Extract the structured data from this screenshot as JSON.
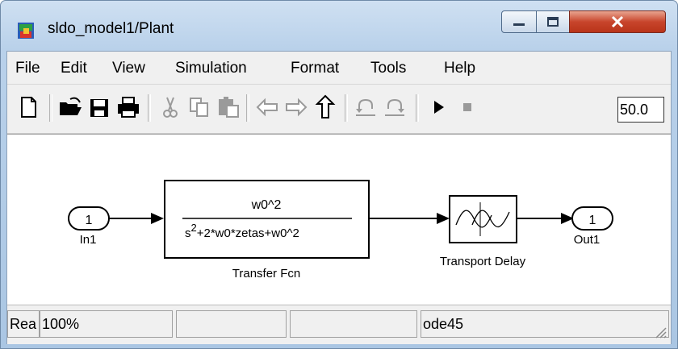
{
  "window": {
    "title": "sldo_model1/Plant"
  },
  "menu": [
    "File",
    "Edit",
    "View",
    "Simulation",
    "Format",
    "Tools",
    "Help"
  ],
  "toolbar": {
    "icons": [
      "new-icon",
      "open-icon",
      "save-icon",
      "print-icon",
      "cut-icon",
      "copy-icon",
      "paste-icon",
      "back-icon",
      "forward-icon",
      "up-icon",
      "undo-icon",
      "redo-icon",
      "play-icon",
      "stop-icon"
    ],
    "stop_time": "50.0"
  },
  "diagram": {
    "inport": {
      "number": "1",
      "label": "In1"
    },
    "transfer_fcn": {
      "numerator": "w0^2",
      "den_s": "s",
      "den_exp": "2",
      "den_rest": "+2*w0*zetas+w0^2",
      "label": "Transfer Fcn"
    },
    "transport_delay": {
      "label": "Transport Delay"
    },
    "outport": {
      "number": "1",
      "label": "Out1"
    }
  },
  "status": {
    "ready": "Rea",
    "zoom": "100%",
    "panel3": "",
    "panel4": "",
    "solver": "ode45"
  },
  "colors": {
    "close_button": "#c8452c",
    "titlebar": "#b9d1ea",
    "canvas": "#ffffff"
  }
}
